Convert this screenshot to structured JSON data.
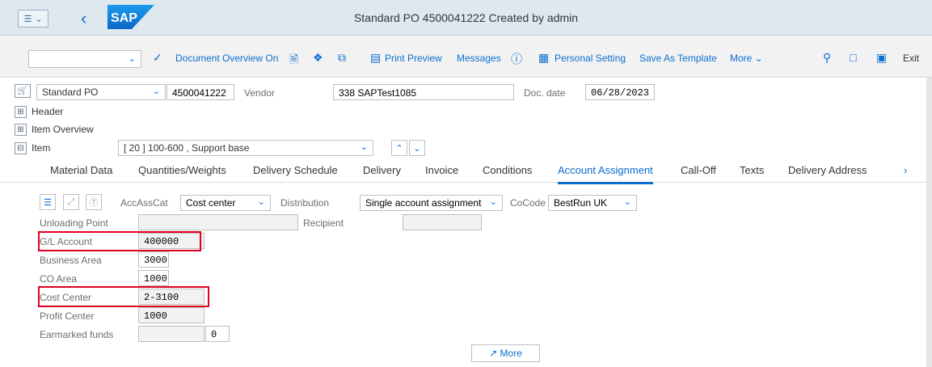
{
  "titlebar": {
    "title": "Standard PO 4500041222 Created by admin",
    "logo_text": "SAP"
  },
  "toolbar": {
    "document_overview": "Document Overview On",
    "print_preview": "Print Preview",
    "messages": "Messages",
    "personal_setting": "Personal Setting",
    "save_as_template": "Save As Template",
    "more": "More",
    "exit": "Exit"
  },
  "header": {
    "doc_type": "Standard PO",
    "po_number": "4500041222",
    "vendor_label": "Vendor",
    "vendor_value": "338 SAPTest1085",
    "doc_date_label": "Doc. date",
    "doc_date_value": "06/28/2023",
    "header_label": "Header",
    "item_overview_label": "Item Overview",
    "item_label": "Item",
    "item_value": "[ 20 ] 100-600 , Support base"
  },
  "tabs": [
    "Material Data",
    "Quantities/Weights",
    "Delivery Schedule",
    "Delivery",
    "Invoice",
    "Conditions",
    "Account Assignment",
    "Call-Off",
    "Texts",
    "Delivery Address"
  ],
  "account": {
    "accasscat_label": "AccAssCat",
    "accasscat_value": "Cost center",
    "distribution_label": "Distribution",
    "distribution_value": "Single account assignment",
    "cocode_label": "CoCode",
    "cocode_value": "BestRun UK",
    "unloading_point_label": "Unloading Point",
    "recipient_label": "Recipient",
    "gl_account_label": "G/L Account",
    "gl_account_value": "400000",
    "business_area_label": "Business Area",
    "business_area_value": "3000",
    "co_area_label": "CO Area",
    "co_area_value": "1000",
    "cost_center_label": "Cost Center",
    "cost_center_value": "2-3100",
    "profit_center_label": "Profit Center",
    "profit_center_value": "1000",
    "earmarked_funds_label": "Earmarked funds",
    "earmarked_funds_value": "0",
    "more_label": "More"
  }
}
